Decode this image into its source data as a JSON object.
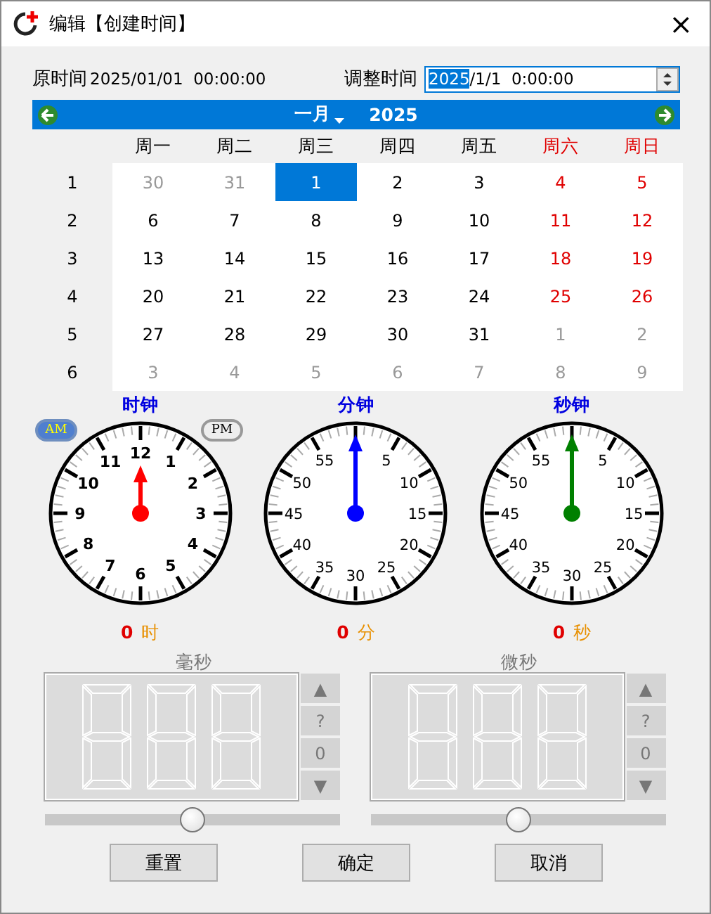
{
  "window": {
    "title": "编辑【创建时间】",
    "close": "×"
  },
  "original": {
    "label": "原时间",
    "value": "2025/01/01  00:00:00"
  },
  "adjust": {
    "label": "调整时间",
    "value_selected": "2025",
    "value_rest": "/1/1  0:00:00"
  },
  "calendar": {
    "month": "一月",
    "year": "2025",
    "weekdays": [
      {
        "label": "周一",
        "weekend": false
      },
      {
        "label": "周二",
        "weekend": false
      },
      {
        "label": "周三",
        "weekend": false
      },
      {
        "label": "周四",
        "weekend": false
      },
      {
        "label": "周五",
        "weekend": false
      },
      {
        "label": "周六",
        "weekend": true
      },
      {
        "label": "周日",
        "weekend": true
      }
    ],
    "weeks": [
      {
        "number": "1",
        "days": [
          {
            "day": "30",
            "muted": true,
            "selected": false
          },
          {
            "day": "31",
            "muted": true,
            "selected": false
          },
          {
            "day": "1",
            "muted": false,
            "selected": true
          },
          {
            "day": "2",
            "muted": false,
            "selected": false
          },
          {
            "day": "3",
            "muted": false,
            "selected": false
          },
          {
            "day": "4",
            "muted": false,
            "selected": false
          },
          {
            "day": "5",
            "muted": false,
            "selected": false
          }
        ]
      },
      {
        "number": "2",
        "days": [
          {
            "day": "6",
            "muted": false,
            "selected": false
          },
          {
            "day": "7",
            "muted": false,
            "selected": false
          },
          {
            "day": "8",
            "muted": false,
            "selected": false
          },
          {
            "day": "9",
            "muted": false,
            "selected": false
          },
          {
            "day": "10",
            "muted": false,
            "selected": false
          },
          {
            "day": "11",
            "muted": false,
            "selected": false
          },
          {
            "day": "12",
            "muted": false,
            "selected": false
          }
        ]
      },
      {
        "number": "3",
        "days": [
          {
            "day": "13",
            "muted": false,
            "selected": false
          },
          {
            "day": "14",
            "muted": false,
            "selected": false
          },
          {
            "day": "15",
            "muted": false,
            "selected": false
          },
          {
            "day": "16",
            "muted": false,
            "selected": false
          },
          {
            "day": "17",
            "muted": false,
            "selected": false
          },
          {
            "day": "18",
            "muted": false,
            "selected": false
          },
          {
            "day": "19",
            "muted": false,
            "selected": false
          }
        ]
      },
      {
        "number": "4",
        "days": [
          {
            "day": "20",
            "muted": false,
            "selected": false
          },
          {
            "day": "21",
            "muted": false,
            "selected": false
          },
          {
            "day": "22",
            "muted": false,
            "selected": false
          },
          {
            "day": "23",
            "muted": false,
            "selected": false
          },
          {
            "day": "24",
            "muted": false,
            "selected": false
          },
          {
            "day": "25",
            "muted": false,
            "selected": false
          },
          {
            "day": "26",
            "muted": false,
            "selected": false
          }
        ]
      },
      {
        "number": "5",
        "days": [
          {
            "day": "27",
            "muted": false,
            "selected": false
          },
          {
            "day": "28",
            "muted": false,
            "selected": false
          },
          {
            "day": "29",
            "muted": false,
            "selected": false
          },
          {
            "day": "30",
            "muted": false,
            "selected": false
          },
          {
            "day": "31",
            "muted": false,
            "selected": false
          },
          {
            "day": "1",
            "muted": true,
            "selected": false
          },
          {
            "day": "2",
            "muted": true,
            "selected": false
          }
        ]
      },
      {
        "number": "6",
        "days": [
          {
            "day": "3",
            "muted": true,
            "selected": false
          },
          {
            "day": "4",
            "muted": true,
            "selected": false
          },
          {
            "day": "5",
            "muted": true,
            "selected": false
          },
          {
            "day": "6",
            "muted": true,
            "selected": false
          },
          {
            "day": "7",
            "muted": true,
            "selected": false
          },
          {
            "day": "8",
            "muted": true,
            "selected": false
          },
          {
            "day": "9",
            "muted": true,
            "selected": false
          }
        ]
      }
    ]
  },
  "meridiem": [
    {
      "label": "AM",
      "selected": true
    },
    {
      "label": "PM",
      "selected": false
    }
  ],
  "clocks": [
    {
      "title": "时钟",
      "kind": "hour",
      "color": "#ff0000",
      "labels": [
        "12",
        "1",
        "2",
        "3",
        "4",
        "5",
        "6",
        "7",
        "8",
        "9",
        "10",
        "11"
      ],
      "reading": "0",
      "unit": "时"
    },
    {
      "title": "分钟",
      "kind": "minute",
      "color": "#0000ff",
      "labels": [
        "5",
        "10",
        "15",
        "20",
        "25",
        "30",
        "35",
        "40",
        "45",
        "50",
        "55"
      ],
      "reading": "0",
      "unit": "分"
    },
    {
      "title": "秒钟",
      "kind": "minute",
      "color": "#008000",
      "labels": [
        "5",
        "10",
        "15",
        "20",
        "25",
        "30",
        "35",
        "40",
        "45",
        "50",
        "55"
      ],
      "reading": "0",
      "unit": "秒"
    }
  ],
  "counters": [
    {
      "title": "毫秒",
      "buttons": [
        "▲",
        "?",
        "0",
        "▼"
      ],
      "level": 0.5
    },
    {
      "title": "微秒",
      "buttons": [
        "▲",
        "?",
        "0",
        "▼"
      ],
      "level": 0.5
    }
  ],
  "buttons": [
    "重置",
    "确定",
    "取消"
  ]
}
